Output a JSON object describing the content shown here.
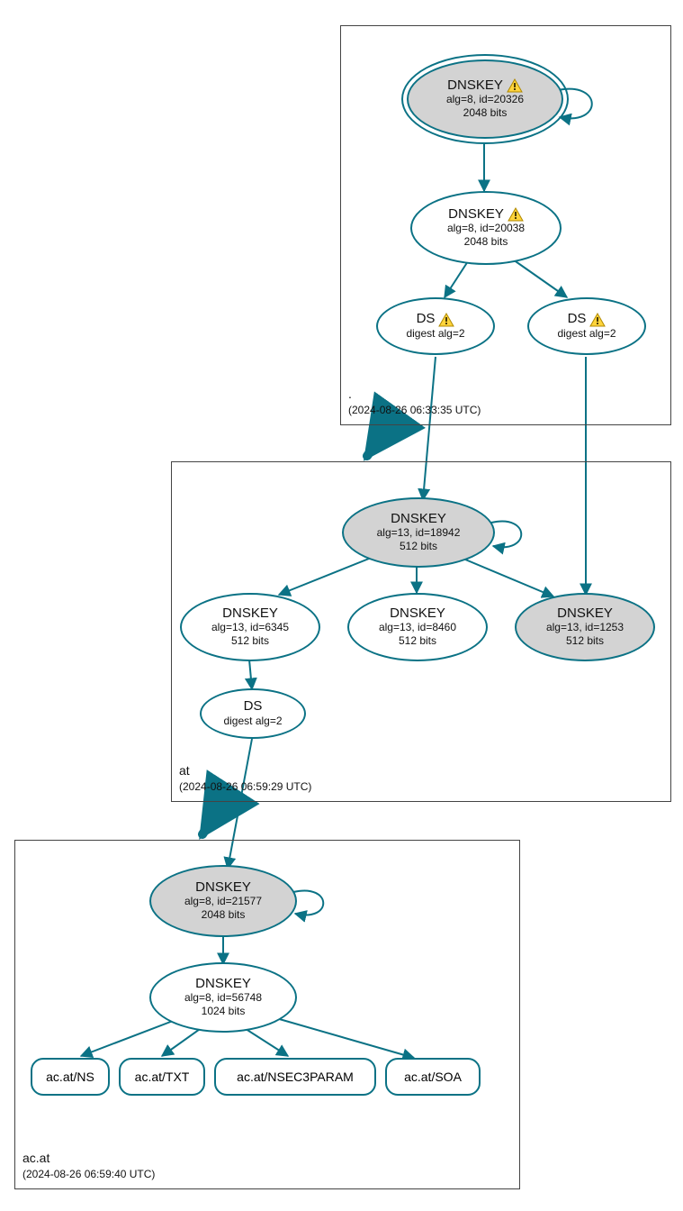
{
  "colors": {
    "stroke": "#0b7285",
    "fill_grey": "#d3d3d3"
  },
  "zones": {
    "root": {
      "name": ".",
      "timestamp": "(2024-08-26 06:33:35 UTC)"
    },
    "at": {
      "name": "at",
      "timestamp": "(2024-08-26 06:59:29 UTC)"
    },
    "acat": {
      "name": "ac.at",
      "timestamp": "(2024-08-26 06:59:40 UTC)"
    }
  },
  "nodes": {
    "root_ksk": {
      "title": "DNSKEY",
      "line1": "alg=8, id=20326",
      "line2": "2048 bits",
      "warn": true
    },
    "root_zsk": {
      "title": "DNSKEY",
      "line1": "alg=8, id=20038",
      "line2": "2048 bits",
      "warn": true
    },
    "root_ds_l": {
      "title": "DS",
      "line1": "digest alg=2",
      "warn": true
    },
    "root_ds_r": {
      "title": "DS",
      "line1": "digest alg=2",
      "warn": true
    },
    "at_ksk": {
      "title": "DNSKEY",
      "line1": "alg=13, id=18942",
      "line2": "512 bits"
    },
    "at_zsk1": {
      "title": "DNSKEY",
      "line1": "alg=13, id=6345",
      "line2": "512 bits"
    },
    "at_zsk2": {
      "title": "DNSKEY",
      "line1": "alg=13, id=8460",
      "line2": "512 bits"
    },
    "at_zsk3": {
      "title": "DNSKEY",
      "line1": "alg=13, id=1253",
      "line2": "512 bits"
    },
    "at_ds": {
      "title": "DS",
      "line1": "digest alg=2"
    },
    "acat_ksk": {
      "title": "DNSKEY",
      "line1": "alg=8, id=21577",
      "line2": "2048 bits"
    },
    "acat_zsk": {
      "title": "DNSKEY",
      "line1": "alg=8, id=56748",
      "line2": "1024 bits"
    }
  },
  "rr": {
    "ns": "ac.at/NS",
    "txt": "ac.at/TXT",
    "n3p": "ac.at/NSEC3PARAM",
    "soa": "ac.at/SOA"
  }
}
